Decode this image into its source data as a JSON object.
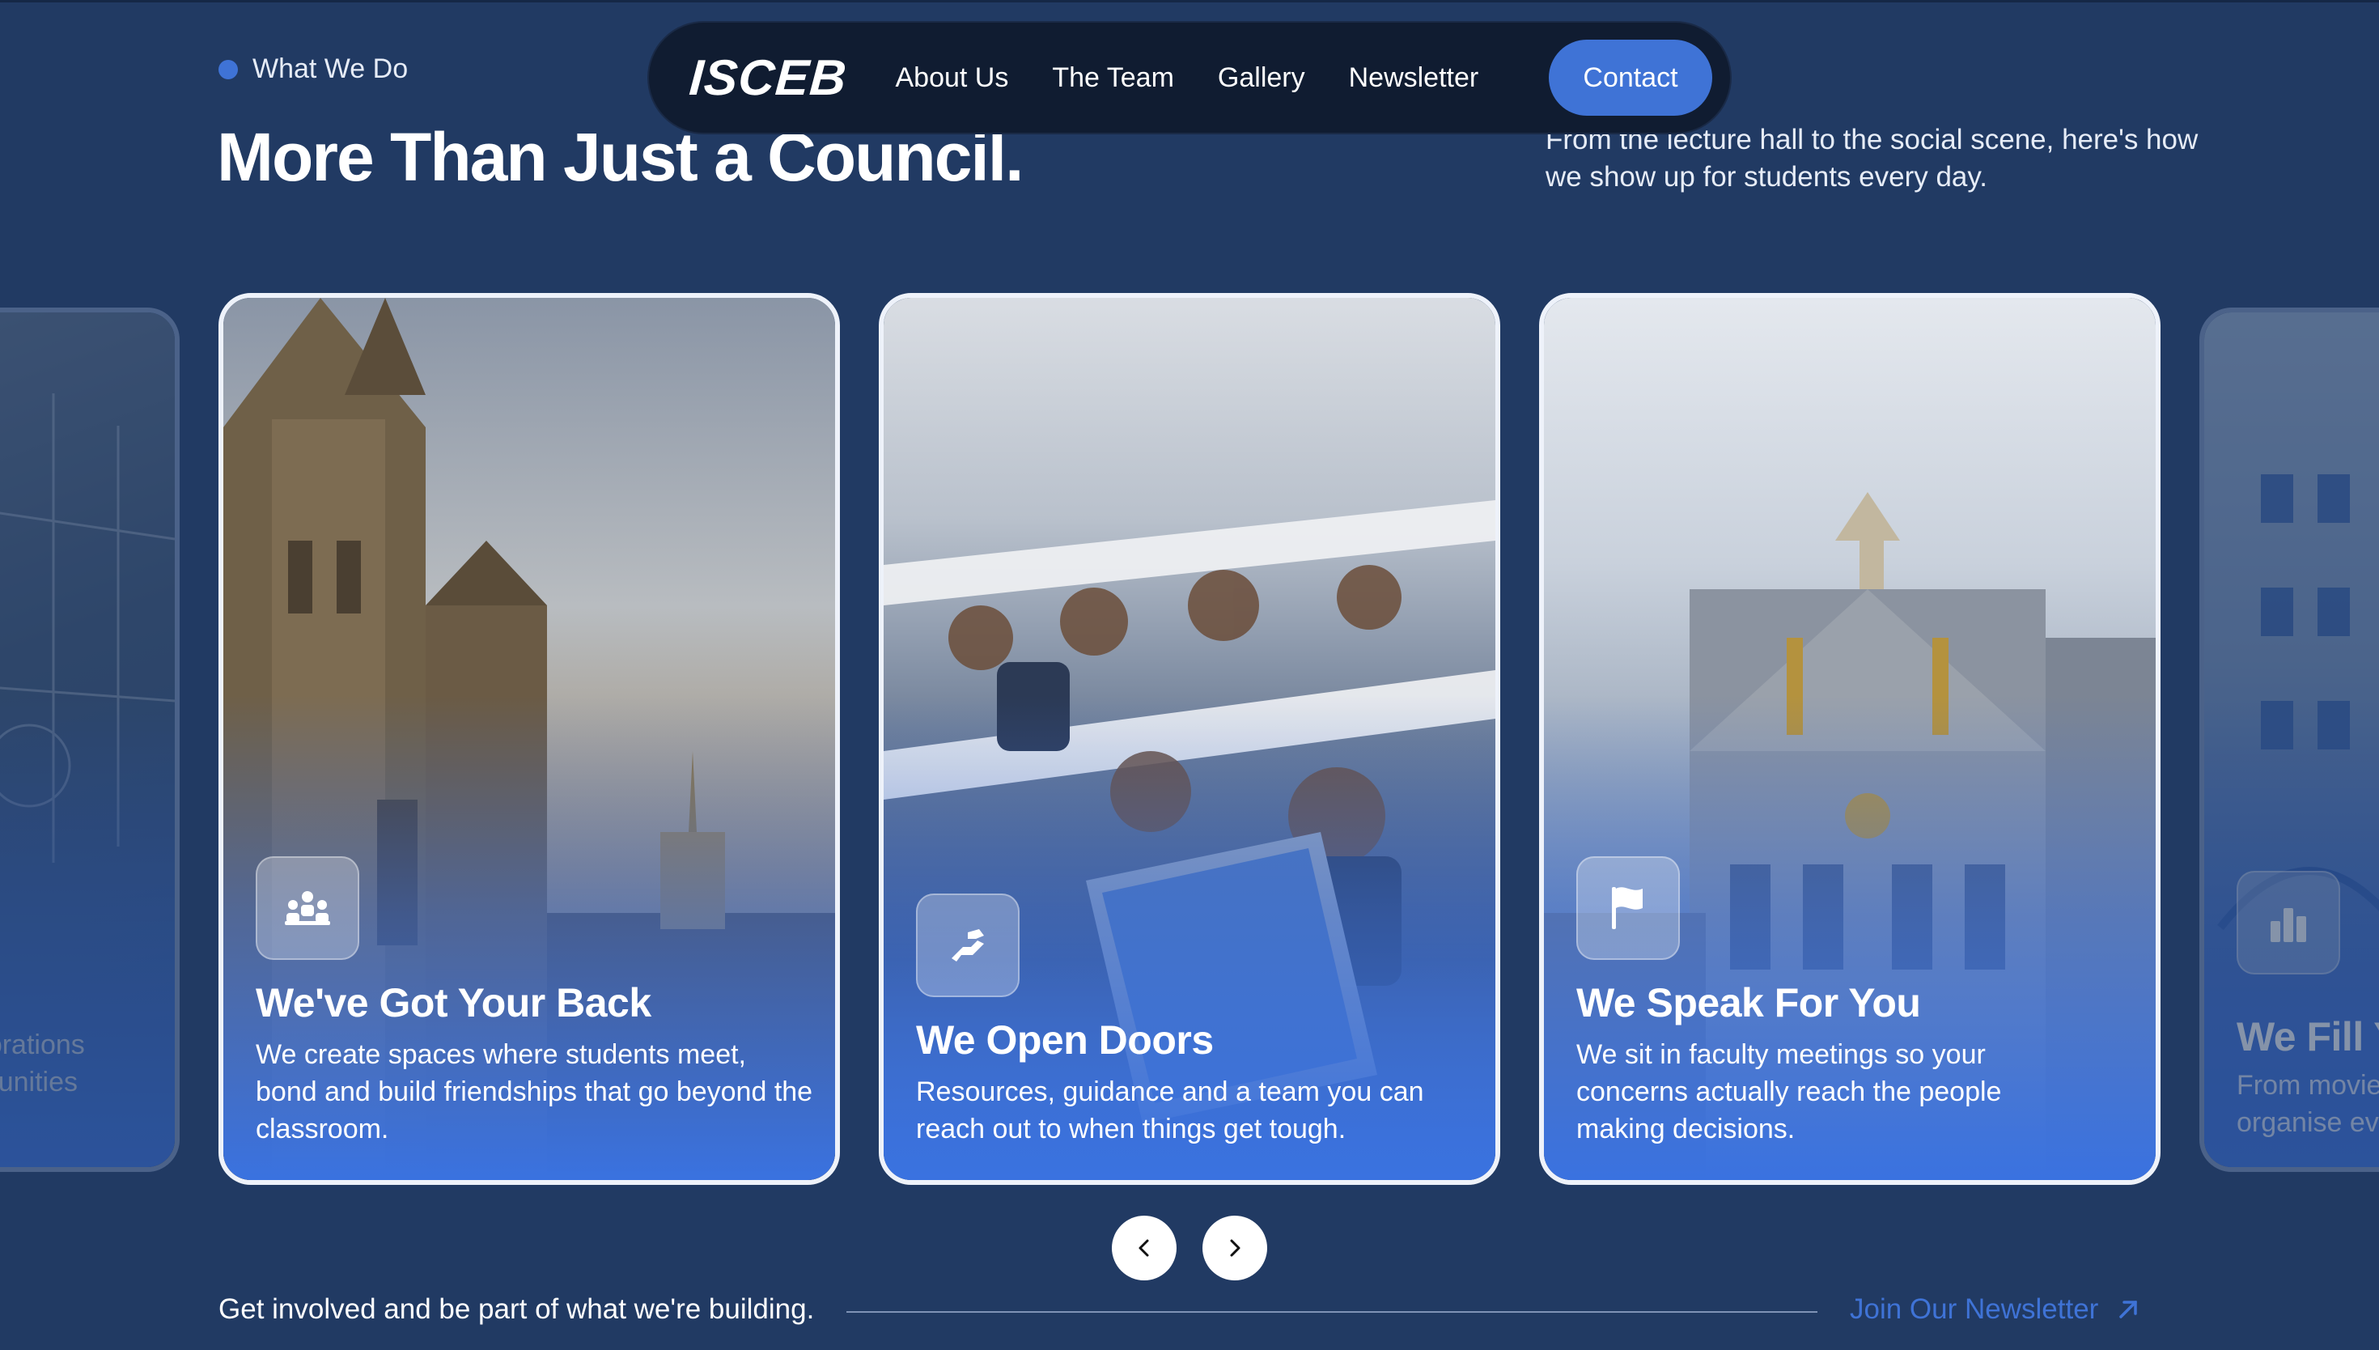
{
  "section": {
    "eyebrow": "What We Do",
    "headline": "More Than Just a Council.",
    "intro": "From the lecture hall to the social scene, here's how we show up for students every day."
  },
  "nav": {
    "logo": "ISCEB",
    "links": [
      "About Us",
      "The Team",
      "Gallery",
      "Newsletter"
    ],
    "contact_label": "Contact"
  },
  "cards": [
    {
      "title": "",
      "desc": "...laborations\n...rtunities",
      "desc_lines": [
        "aborations",
        "rtunities"
      ],
      "icon": "none"
    },
    {
      "title": "We've Got Your Back",
      "desc": "We create spaces where students meet, bond and build friendships that go beyond the classroom.",
      "icon": "people-group-icon"
    },
    {
      "title": "We Open Doors",
      "desc": "Resources, guidance and a team you can reach out to when things get tough.",
      "icon": "helping-hand-icon"
    },
    {
      "title": "We Speak For You",
      "desc": "We sit in faculty meetings so your concerns actually reach the people making decisions.",
      "icon": "flag-icon"
    },
    {
      "title": "We Fill Y",
      "desc_lines": [
        "From movie",
        "organise ev"
      ],
      "icon": "bar-chart-icon"
    }
  ],
  "carousel": {
    "prev_icon": "chevron-left-icon",
    "next_icon": "chevron-right-icon"
  },
  "footer": {
    "cta_text": "Get involved and be part of what we're building.",
    "cta_link": "Join Our Newsletter",
    "cta_icon": "arrow-up-right-icon"
  },
  "colors": {
    "background": "#213a63",
    "accent": "#3f73d6",
    "nav_bg": "#101c31",
    "card_gradient": "#3a72e0"
  }
}
